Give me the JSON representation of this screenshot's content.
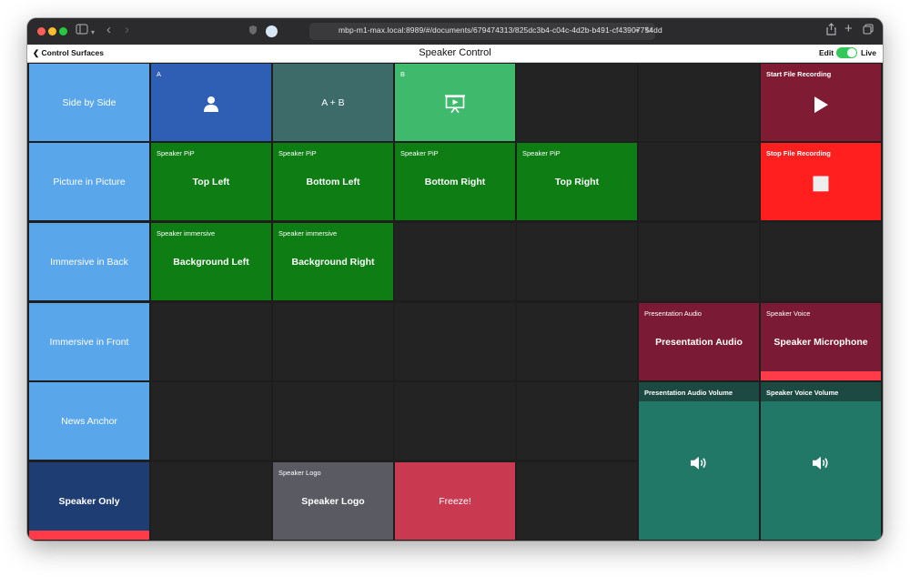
{
  "browser": {
    "url": "mbp-m1-max.local:8989/#/documents/679474313/825dc3b4-c04c-4d2b-b491-cf43907754dd"
  },
  "header": {
    "back_label": "Control Surfaces",
    "title": "Speaker Control",
    "edit_label": "Edit",
    "live_label": "Live"
  },
  "tiles": {
    "side_by_side": "Side by Side",
    "pip": "Picture in Picture",
    "immersive_back": "Immersive in Back",
    "immersive_front": "Immersive in Front",
    "news_anchor": "News Anchor",
    "speaker_only": "Speaker Only",
    "source_a": "A",
    "a_plus_b": "A + B",
    "source_b": "B",
    "pip_sub": "Speaker PiP",
    "top_left": "Top Left",
    "bottom_left": "Bottom Left",
    "bottom_right": "Bottom Right",
    "top_right": "Top Right",
    "immersive_sub": "Speaker immersive",
    "background_left": "Background Left",
    "background_right": "Background Right",
    "logo_sub": "Speaker Logo",
    "logo_main": "Speaker Logo",
    "freeze": "Freeze!",
    "start_recording": "Start File Recording",
    "stop_recording": "Stop File Recording",
    "pres_audio_sub": "Presentation Audio",
    "pres_audio_main": "Presentation Audio",
    "voice_sub": "Speaker Voice",
    "voice_main": "Speaker Microphone",
    "pres_volume": "Presentation Audio Volume",
    "voice_volume": "Speaker Voice Volume"
  },
  "colors": {
    "layout_blue": "#5aa6ea",
    "speaker_only_navy": "#1e3d72",
    "source_a_blue": "#2e5fb5",
    "a_plus_b_teal": "#3c6b6a",
    "source_b_green": "#3fba6c",
    "pip_green": "#0d7d14",
    "logo_gray": "#5a5a63",
    "freeze_red": "#c93950",
    "start_rec_maroon": "#7f1c33",
    "stop_rec_red": "#ff1f1f",
    "audio_maroon": "#7b1a35",
    "volume_teal": "#217866",
    "active_bar": "#ff3b4a",
    "toggle_green": "#34c759"
  }
}
